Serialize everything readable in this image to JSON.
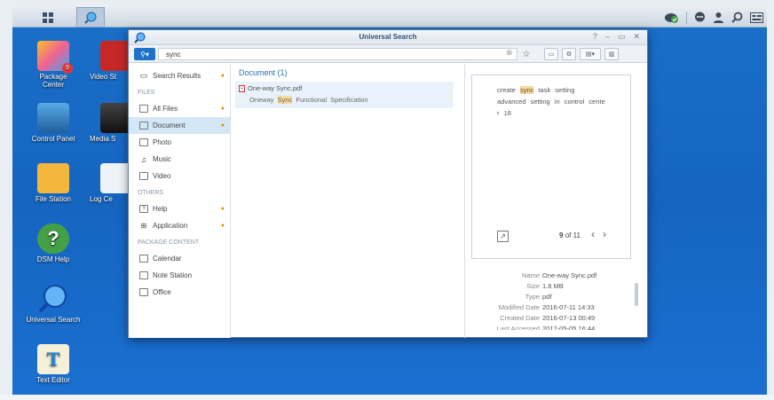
{
  "desktop_icons": [
    {
      "label": "Package\nCenter",
      "icon": "package-icon",
      "badge": "9"
    },
    {
      "label": "Video St",
      "icon": "video-icon"
    },
    {
      "label": "Control Panel",
      "icon": "control-panel-icon"
    },
    {
      "label": "Media S",
      "icon": "media-icon"
    },
    {
      "label": "File Station",
      "icon": "folder-search-icon"
    },
    {
      "label": "Log Ce",
      "icon": "log-icon"
    },
    {
      "label": "DSM Help",
      "icon": "help-icon"
    },
    {
      "label": "Universal Search",
      "icon": "search-globe-icon"
    },
    {
      "label": "Text Editor",
      "icon": "text-editor-icon"
    }
  ],
  "window": {
    "title": "Universal Search",
    "controls": [
      "?",
      "–",
      "▭",
      "✕"
    ]
  },
  "search": {
    "query": "sync"
  },
  "sidebar": {
    "search_results": "Search Results",
    "files_head": "FILES",
    "files": [
      {
        "label": "All Files",
        "dot": true
      },
      {
        "label": "Document",
        "dot": true,
        "selected": true
      },
      {
        "label": "Photo",
        "dot": false
      },
      {
        "label": "Music",
        "dot": false
      },
      {
        "label": "Video",
        "dot": false
      }
    ],
    "others_head": "OTHERS",
    "others": [
      {
        "label": "Help",
        "dot": true
      },
      {
        "label": "Application",
        "dot": true
      }
    ],
    "package_head": "PACKAGE CONTENT",
    "package": [
      {
        "label": "Calendar"
      },
      {
        "label": "Note Station"
      },
      {
        "label": "Office"
      }
    ]
  },
  "results": {
    "title": "Document (1)",
    "item_name": "One-way Sync.pdf",
    "snippet_pre": "Oneway",
    "snippet_hl": "Sync",
    "snippet_post": "Functional  Specification"
  },
  "preview": {
    "line1_pre": "create",
    "line1_hl": "sync",
    "line1_post": "task  setting",
    "line2": "advanced  setting  in  control  cente",
    "line3": "r  18",
    "page_current": "9",
    "page_of": "of 11"
  },
  "properties": [
    {
      "label": "Name",
      "value": "One-way Sync.pdf"
    },
    {
      "label": "Size",
      "value": "1.8 MB"
    },
    {
      "label": "Type",
      "value": "pdf"
    },
    {
      "label": "Modified Date",
      "value": "2016-07-11 14:33"
    },
    {
      "label": "Created Date",
      "value": "2016-07-13 00:49"
    },
    {
      "label": "Last Accessed",
      "value": "2017-05-05 16:44"
    }
  ],
  "colors": {
    "desktop": "#1565c0",
    "accent": "#1e72c8",
    "highlight": "#fbd99a",
    "selected": "#d4e7f7"
  }
}
